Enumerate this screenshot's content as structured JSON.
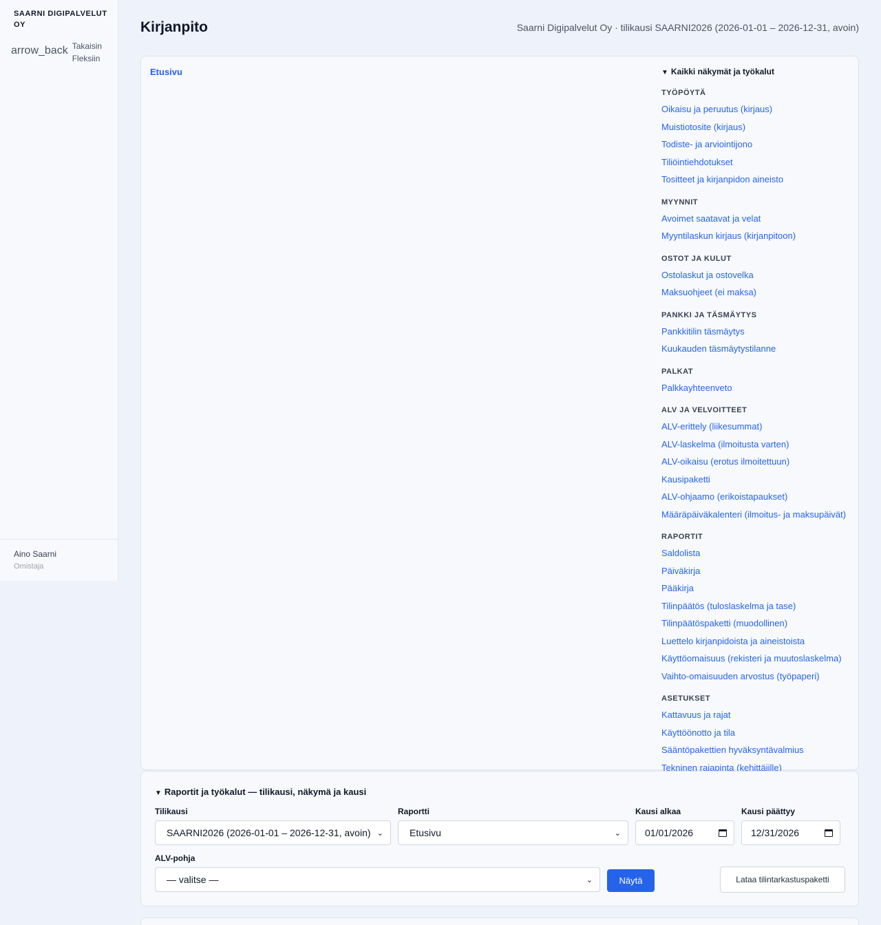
{
  "sidebar": {
    "brand": "SAARNI DIGIPALVELUT OY",
    "back_icon": "arrow_back",
    "back_label": "Takaisin Fleksiin",
    "user_name": "Aino Saarni",
    "user_role": "Omistaja"
  },
  "header": {
    "title": "Kirjanpito",
    "context": "Saarni Digipalvelut Oy · tilikausi SAARNI2026 (2026-01-01 – 2026-12-31, avoin)"
  },
  "main": {
    "breadcrumb": "Etusivu",
    "nav_summary": "Kaikki näkymät ja työkalut",
    "groups": [
      {
        "title": "TYÖPÖYTÄ",
        "items": [
          "Oikaisu ja peruutus (kirjaus)",
          "Muistiotosite (kirjaus)",
          "Todiste- ja arviointijono",
          "Tiliöintiehdotukset",
          "Tositteet ja kirjanpidon aineisto"
        ]
      },
      {
        "title": "MYYNNIT",
        "items": [
          "Avoimet saatavat ja velat",
          "Myyntilaskun kirjaus (kirjanpitoon)"
        ]
      },
      {
        "title": "OSTOT JA KULUT",
        "items": [
          "Ostolaskut ja ostovelka",
          "Maksuohjeet (ei maksa)"
        ]
      },
      {
        "title": "PANKKI JA TÄSMÄYTYS",
        "items": [
          "Pankkitilin täsmäytys",
          "Kuukauden täsmäytystilanne"
        ]
      },
      {
        "title": "PALKAT",
        "items": [
          "Palkkayhteenveto"
        ]
      },
      {
        "title": "ALV JA VELVOITTEET",
        "items": [
          "ALV-erittely (liikesummat)",
          "ALV-laskelma (ilmoitusta varten)",
          "ALV-oikaisu (erotus ilmoitettuun)",
          "Kausipaketti",
          "ALV-ohjaamo (erikoistapaukset)",
          "Määräpäiväkalenteri (ilmoitus- ja maksupäivät)"
        ]
      },
      {
        "title": "RAPORTIT",
        "items": [
          "Saldolista",
          "Päiväkirja",
          "Pääkirja",
          "Tilinpäätös (tuloslaskelma ja tase)",
          "Tilinpäätöspaketti (muodollinen)",
          "Luettelo kirjanpidoista ja aineistoista",
          "Käyttöomaisuus (rekisteri ja muutoslaskelma)",
          "Vaihto-omaisuuden arvostus (työpaperi)"
        ]
      },
      {
        "title": "ASETUKSET",
        "items": [
          "Kattavuus ja rajat",
          "Käyttöönotto ja tila",
          "Sääntöpakettien hyväksyntävalmius",
          "Tekninen rajapinta (kehittäjille)"
        ]
      }
    ]
  },
  "tools": {
    "summary": "Raportit ja työkalut — tilikausi, näkymä ja kausi",
    "fiscal_label": "Tilikausi",
    "fiscal_value": "SAARNI2026 (2026-01-01 – 2026-12-31, avoin)",
    "report_label": "Raportti",
    "report_value": "Etusivu",
    "start_label": "Kausi alkaa",
    "start_value": "01/01/2026",
    "end_label": "Kausi päättyy",
    "end_value": "12/31/2026",
    "vat_label": "ALV-pohja",
    "vat_value": "— valitse —",
    "show_button": "Näytä",
    "download_button": "Lataa tilintarkastuspaketti"
  }
}
